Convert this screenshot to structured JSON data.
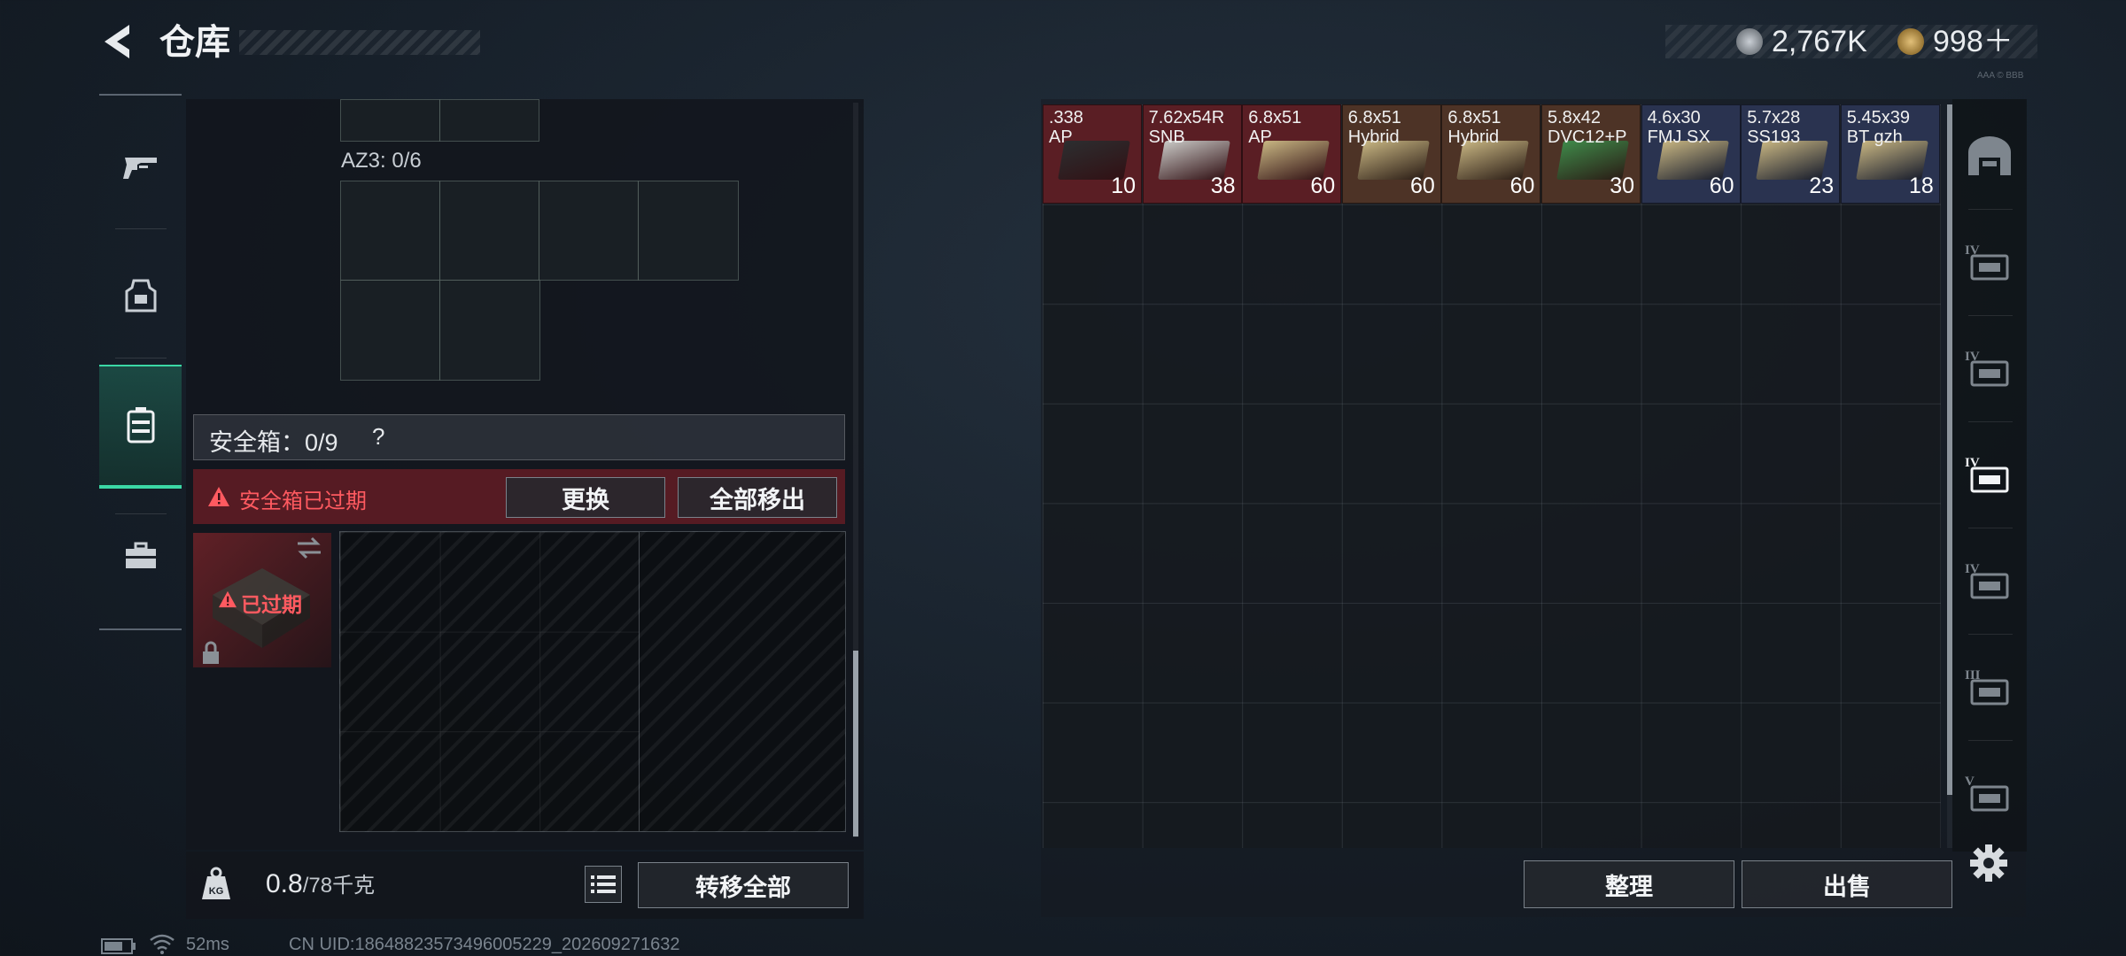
{
  "header": {
    "title": "仓库",
    "currency_1": "2,767K",
    "currency_2": "998＋",
    "deco_text": "AAA © BBB"
  },
  "left_categories": [
    {
      "name": "weapons",
      "icon": "gun-icon"
    },
    {
      "name": "equipment",
      "icon": "vest-icon"
    },
    {
      "name": "containers",
      "icon": "case-icon",
      "active": true
    },
    {
      "name": "tools",
      "icon": "toolbox-icon"
    }
  ],
  "loadout": {
    "az3_label": "AZ3: 0/6",
    "safe_box_title": "安全箱：0/9",
    "help_symbol": "?",
    "expired_warning": "安全箱已过期",
    "replace_button": "更换",
    "remove_all_button": "全部移出",
    "case_expired_label": "已过期"
  },
  "footer_left": {
    "weight_value": "0.8",
    "weight_max": "/78千克",
    "weight_icon_text": "KG",
    "transfer_all_button": "转移全部"
  },
  "stash": {
    "items": [
      {
        "name": ".338\nAP",
        "count": "10",
        "bg": "#5a1e24",
        "box": "#2c2e30"
      },
      {
        "name": "7.62x54R\nSNB",
        "count": "38",
        "bg": "#5a1e24",
        "box": "#c9c9c6"
      },
      {
        "name": "6.8x51\nAP",
        "count": "60",
        "bg": "#5a1e24",
        "box": "#c7b582"
      },
      {
        "name": "6.8x51\nHybrid",
        "count": "60",
        "bg": "#4d3326",
        "box": "#c7b582"
      },
      {
        "name": "6.8x51\nHybrid",
        "count": "60",
        "bg": "#4d3326",
        "box": "#c7b582"
      },
      {
        "name": "5.8x42\nDVC12+P",
        "count": "30",
        "bg": "#4d3326",
        "box": "#3f8a4a"
      },
      {
        "name": "4.6x30\nFMJ SX",
        "count": "60",
        "bg": "#2a3350",
        "box": "#c7b582"
      },
      {
        "name": "5.7x28\nSS193",
        "count": "23",
        "bg": "#2a3350",
        "box": "#c7b582"
      },
      {
        "name": "5.45x39\nBT gzh",
        "count": "18",
        "bg": "#2a3350",
        "box": "#c7b582"
      }
    ],
    "sort_button": "整理",
    "sell_button": "出售"
  },
  "side_tabs": [
    {
      "name": "stash-tab",
      "label": ""
    },
    {
      "name": "armor-tab",
      "label": "IV"
    },
    {
      "name": "medical-tab",
      "label": "IV"
    },
    {
      "name": "container-tab",
      "label": "IV",
      "active": true
    },
    {
      "name": "weapon-tab",
      "label": "IV"
    },
    {
      "name": "attachment-tab",
      "label": "III"
    },
    {
      "name": "parts-tab",
      "label": "V"
    }
  ],
  "status": {
    "ping": "52ms",
    "uid": "CN UID:18648823573496005229_202609271632"
  },
  "colors": {
    "accent_green": "#3bd8a5",
    "warning_red": "#ff5a60"
  }
}
